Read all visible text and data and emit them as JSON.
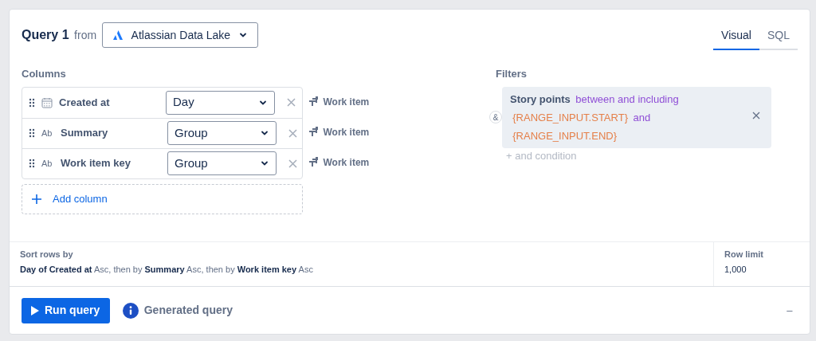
{
  "query": {
    "title": "Query 1",
    "from_label": "from",
    "source": "Atlassian Data Lake"
  },
  "mode_tabs": [
    {
      "label": "Visual",
      "selected": true
    },
    {
      "label": "SQL",
      "selected": false
    }
  ],
  "columns_heading": "Columns",
  "columns": [
    {
      "name": "Created at",
      "kind": "date",
      "aggregation": "Day",
      "entity": "Work item"
    },
    {
      "name": "Summary",
      "kind": "text",
      "type_label": "Ab",
      "aggregation": "Group",
      "entity": "Work item"
    },
    {
      "name": "Work item key",
      "kind": "text",
      "type_label": "Ab",
      "aggregation": "Group",
      "entity": "Work item"
    }
  ],
  "add_column": "Add column",
  "filters_heading": "Filters",
  "filter": {
    "connector": "&",
    "field": "Story points",
    "operator": "between and including",
    "start": "{RANGE_INPUT.START}",
    "joiner": "and",
    "end": "{RANGE_INPUT.END}"
  },
  "add_condition": "+ and condition",
  "sort": {
    "label": "Sort rows by",
    "text": "**Day of Created at** Asc, then by **Summary** Asc, then by **Work item key** Asc"
  },
  "row_limit": {
    "label": "Row limit",
    "value": "1,000"
  },
  "run_button": "Run query",
  "generated_query": "Generated query",
  "collapse": "–"
}
